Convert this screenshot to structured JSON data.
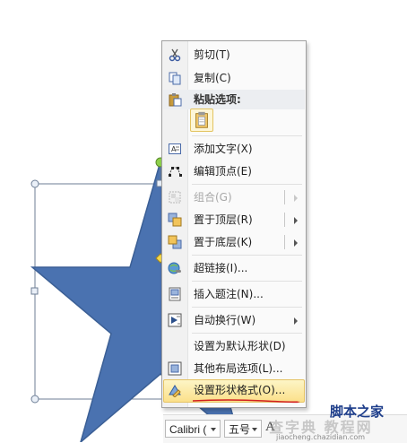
{
  "context_menu": {
    "items": [
      {
        "label": "剪切(T)",
        "icon": "scissors-icon",
        "disabled": false
      },
      {
        "label": "复制(C)",
        "icon": "copy-icon",
        "disabled": false
      },
      {
        "label": "粘贴选项:",
        "icon": "paste-icon",
        "header": true
      },
      {
        "label": "添加文字(X)",
        "icon": "text-box-icon",
        "disabled": false
      },
      {
        "label": "编辑顶点(E)",
        "icon": "edit-points-icon",
        "disabled": false
      },
      {
        "label": "组合(G)",
        "icon": "group-icon",
        "disabled": true,
        "submenu": true
      },
      {
        "label": "置于顶层(R)",
        "icon": "bring-to-front-icon",
        "disabled": false,
        "submenu": true
      },
      {
        "label": "置于底层(K)",
        "icon": "send-to-back-icon",
        "disabled": false,
        "submenu": true
      },
      {
        "label": "超链接(I)...",
        "icon": "hyperlink-icon",
        "disabled": false
      },
      {
        "label": "插入题注(N)...",
        "icon": "insert-caption-icon",
        "disabled": false
      },
      {
        "label": "自动换行(W)",
        "icon": "wrap-text-icon",
        "disabled": false,
        "submenu": true
      },
      {
        "label": "设置为默认形状(D)",
        "icon": "",
        "disabled": false
      },
      {
        "label": "其他布局选项(L)...",
        "icon": "layout-options-icon",
        "disabled": false
      },
      {
        "label": "设置形状格式(O)...",
        "icon": "format-shape-icon",
        "disabled": false,
        "highlighted": true
      }
    ]
  },
  "mini_toolbar": {
    "font_name": "Calibri (",
    "font_size": "五号",
    "grow_font_glyph": "A"
  },
  "watermark": {
    "brand_line": "脚本之家",
    "site_line": "查字典 教程网",
    "url_line": "jiaocheng.chazidian.com"
  },
  "colors": {
    "star_fill": "#4a72b0",
    "star_stroke": "#3b5f95",
    "highlight": "#fbe08a",
    "handle_green": "#8ed04a"
  }
}
